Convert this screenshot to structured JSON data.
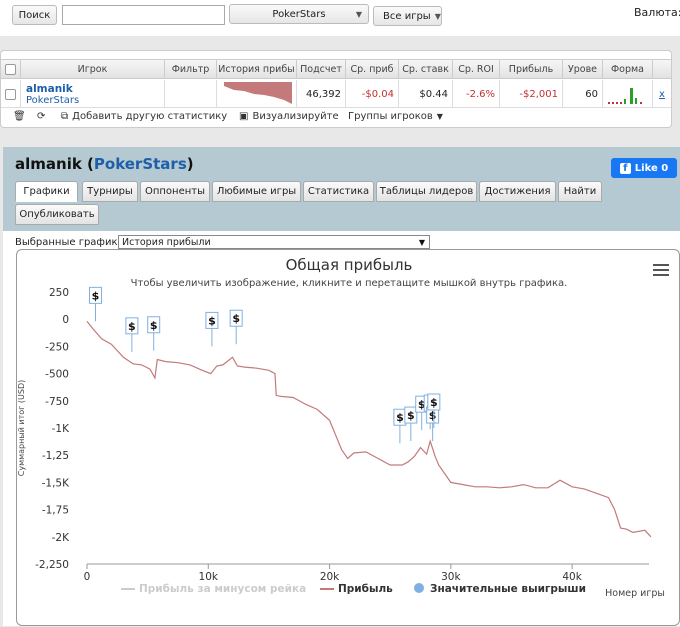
{
  "search": {
    "button": "Поиск",
    "value": ""
  },
  "site_select": "PokerStars",
  "games_button": "Все игры",
  "currency": {
    "label": "Валюта:",
    "value": "$"
  },
  "stats_table": {
    "headers": [
      "Игрок",
      "Фильтр",
      "История прибы",
      "Подсчет",
      "Ср. приб",
      "Ср. ставк",
      "Ср. ROI",
      "Прибыль",
      "Урове",
      "Форма"
    ],
    "row": {
      "player": "almanik",
      "site": "PokerStars",
      "filter": "",
      "count": "46,392",
      "avg_profit": "-$0.04",
      "avg_stake": "$0.44",
      "avg_roi": "-2.6%",
      "profit": "-$2,001",
      "level": "60",
      "remove": "x"
    }
  },
  "toolbar": {
    "add_stats": "Добавить другую статистику",
    "visualize": "Визуализируйте",
    "groups": "Группы игроков"
  },
  "profile": {
    "name": "almanik",
    "site": "PokerStars",
    "like": "Like 0"
  },
  "tabs": [
    "Графики",
    "Турниры",
    "Оппоненты",
    "Любимые игры",
    "Статистика",
    "Таблицы лидеров",
    "Достижения",
    "Найти",
    "Опубликовать"
  ],
  "graph_select": {
    "label": "Выбранные графики:",
    "value": "История прибыли"
  },
  "chart_data": {
    "type": "line",
    "title": "Общая прибыль",
    "subtitle": "Чтобы увеличить изображение, кликните и перетащите мышкой внутрь графика.",
    "xlabel": "Номер игры",
    "ylabel": "Суммарный итог (USD)",
    "xlim": [
      0,
      47000
    ],
    "ylim": [
      -2250,
      250
    ],
    "yticks": [
      250,
      0,
      -250,
      -500,
      -750,
      -1000,
      -1250,
      -1500,
      -1750,
      -2000,
      -2250
    ],
    "ytick_labels": [
      "250",
      "0",
      "-250",
      "-500",
      "-750",
      "-1K",
      "-1,25",
      "-1,5K",
      "-1,75",
      "-2K",
      "-2,250"
    ],
    "xticks": [
      0,
      10000,
      20000,
      30000,
      40000
    ],
    "xtick_labels": [
      "0",
      "10k",
      "20k",
      "30k",
      "40k"
    ],
    "legend": [
      "Прибыль за минусом рейка",
      "Прибыль",
      "Значительные выигрыши"
    ],
    "series": [
      {
        "name": "Прибыль",
        "color": "#c47a7a",
        "x": [
          0,
          500,
          1200,
          2000,
          3000,
          3800,
          4500,
          5200,
          5600,
          5800,
          6500,
          7500,
          8500,
          9500,
          10200,
          10700,
          11200,
          12000,
          12400,
          13000,
          14000,
          15000,
          15500,
          15600,
          16000,
          17000,
          18000,
          19000,
          20000,
          21000,
          21500,
          22000,
          23000,
          24000,
          25000,
          26000,
          26500,
          27000,
          27500,
          28000,
          28300,
          28700,
          29000,
          30000,
          31000,
          32000,
          33000,
          34000,
          35000,
          36000,
          37000,
          38000,
          39000,
          40000,
          41000,
          42000,
          43000,
          43500,
          44000,
          44500,
          45000,
          46000,
          46500
        ],
        "y": [
          -20,
          -90,
          -180,
          -230,
          -350,
          -410,
          -420,
          -460,
          -540,
          -370,
          -390,
          -400,
          -420,
          -470,
          -500,
          -430,
          -420,
          -350,
          -430,
          -440,
          -450,
          -470,
          -500,
          -700,
          -710,
          -720,
          -780,
          -830,
          -930,
          -1200,
          -1280,
          -1230,
          -1220,
          -1280,
          -1340,
          -1340,
          -1310,
          -1260,
          -1180,
          -1240,
          -1120,
          -1260,
          -1340,
          -1500,
          -1520,
          -1540,
          -1540,
          -1550,
          -1540,
          -1520,
          -1550,
          -1550,
          -1480,
          -1540,
          -1560,
          -1600,
          -1640,
          -1750,
          -1920,
          -1930,
          -1960,
          -1940,
          -2000
        ]
      },
      {
        "name": "Прибыль за минусом рейка",
        "color": "#cccccc",
        "x": [],
        "y": []
      }
    ],
    "markers": {
      "name": "Значительные выигрыши",
      "label": "$",
      "points": [
        [
          700,
          -20
        ],
        [
          3700,
          -300
        ],
        [
          5500,
          -290
        ],
        [
          10300,
          -250
        ],
        [
          12300,
          -230
        ],
        [
          25800,
          -1140
        ],
        [
          26700,
          -1120
        ],
        [
          27600,
          -1020
        ],
        [
          28300,
          -1010
        ],
        [
          28500,
          -1120
        ],
        [
          28600,
          -1000
        ]
      ]
    }
  }
}
